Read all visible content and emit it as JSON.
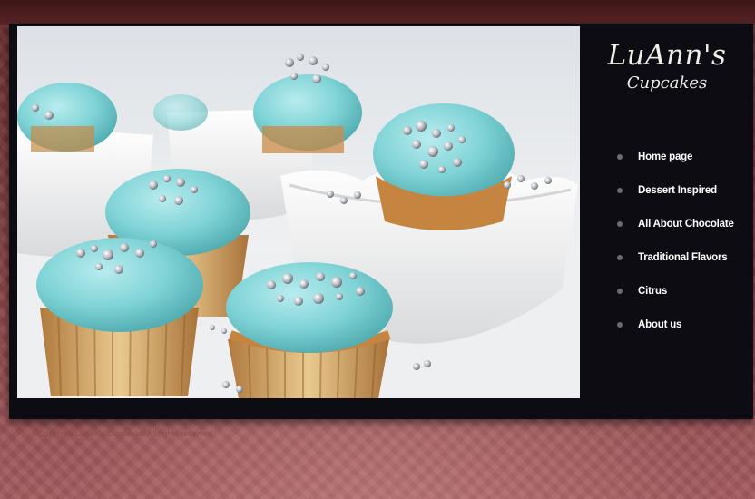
{
  "brand": {
    "script_name": "LuAnn's",
    "subtitle": "Cupcakes"
  },
  "nav": {
    "items": [
      {
        "label": "Home page",
        "icon": "bullet-icon"
      },
      {
        "label": "Dessert Inspired",
        "icon": "bullet-icon"
      },
      {
        "label": "All About Chocolate",
        "icon": "bullet-icon"
      },
      {
        "label": "Traditional Flavors",
        "icon": "bullet-icon"
      },
      {
        "label": "Citrus",
        "icon": "bullet-icon"
      },
      {
        "label": "About us",
        "icon": "bullet-icon"
      }
    ]
  },
  "hero": {
    "subject": "turquoise-frosted cupcakes with silver dragees in white bowls"
  },
  "footer": {
    "text": "Copyright LuAnn's Cupcakes. All rights reserved."
  },
  "colors": {
    "background": "#7d3b3e",
    "panel": "#0d0c12",
    "frosting": "#7fd3d6",
    "nav_text": "#ffffff",
    "bullet": "#6a6a72"
  }
}
